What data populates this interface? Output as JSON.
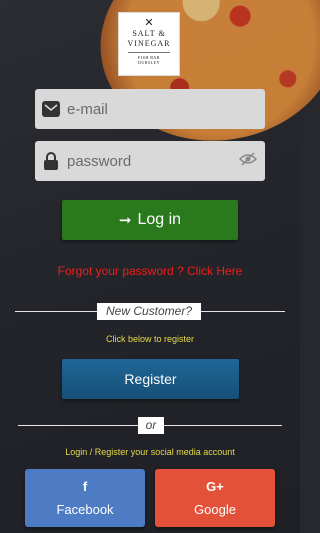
{
  "logo": {
    "line1": "SALT &",
    "line2": "VINEGAR",
    "line3": "FISH BAR",
    "line4": "DURSLEY"
  },
  "login_form": {
    "email_placeholder": "e-mail",
    "password_placeholder": "password",
    "login_label": "Log in",
    "forgot_text": "Forgot your password ? Click Here"
  },
  "register_section": {
    "divider_label": "New Customer?",
    "hint": "Click below to register",
    "register_label": "Register"
  },
  "social_section": {
    "divider_label": "or",
    "hint": "Login / Register your social media account",
    "facebook_label": "Facebook",
    "google_label": "Google",
    "facebook_icon": "f",
    "google_icon": "G+"
  },
  "colors": {
    "login_button": "#2a7a1d",
    "forgot_link": "#e8201c",
    "hint_text": "#e4d94a",
    "register_button": "#1f6796",
    "facebook": "#4d7bc4",
    "google": "#e45139"
  },
  "icons": {
    "email": "envelope-icon",
    "password": "lock-icon",
    "visibility": "eye-slash-icon",
    "login": "arrow-right-icon",
    "facebook": "facebook-icon",
    "google": "google-plus-icon",
    "logo": "fish-cross-icon"
  }
}
